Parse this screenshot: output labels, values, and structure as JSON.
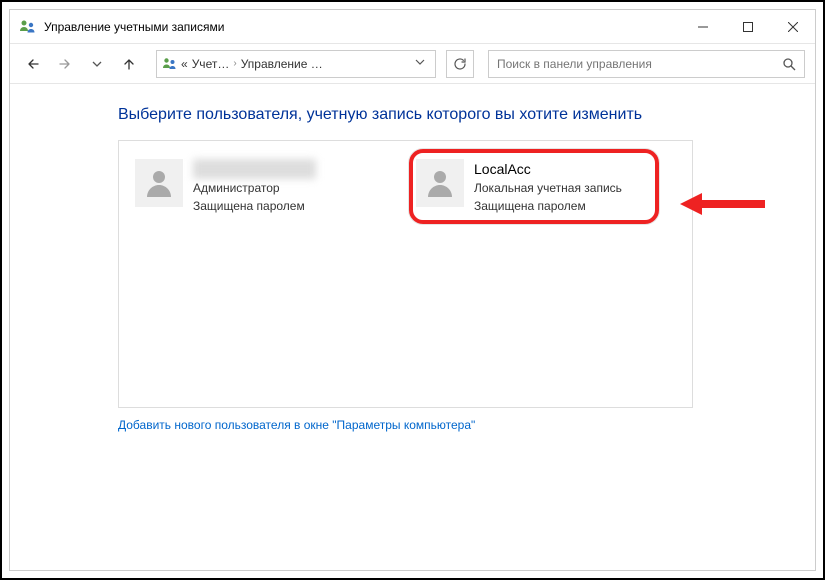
{
  "window": {
    "title": "Управление учетными записями"
  },
  "breadcrumb": {
    "back_chevrons": "«",
    "part1": "Учет…",
    "part2": "Управление …"
  },
  "search": {
    "placeholder": "Поиск в панели управления"
  },
  "page": {
    "title": "Выберите пользователя, учетную запись которого вы хотите изменить"
  },
  "users": [
    {
      "name": "████████ ████",
      "type": "Администратор",
      "protected": "Защищена паролем"
    },
    {
      "name": "LocalAcc",
      "type": "Локальная учетная запись",
      "protected": "Защищена паролем"
    }
  ],
  "add_link": "Добавить нового пользователя в окне \"Параметры компьютера\""
}
